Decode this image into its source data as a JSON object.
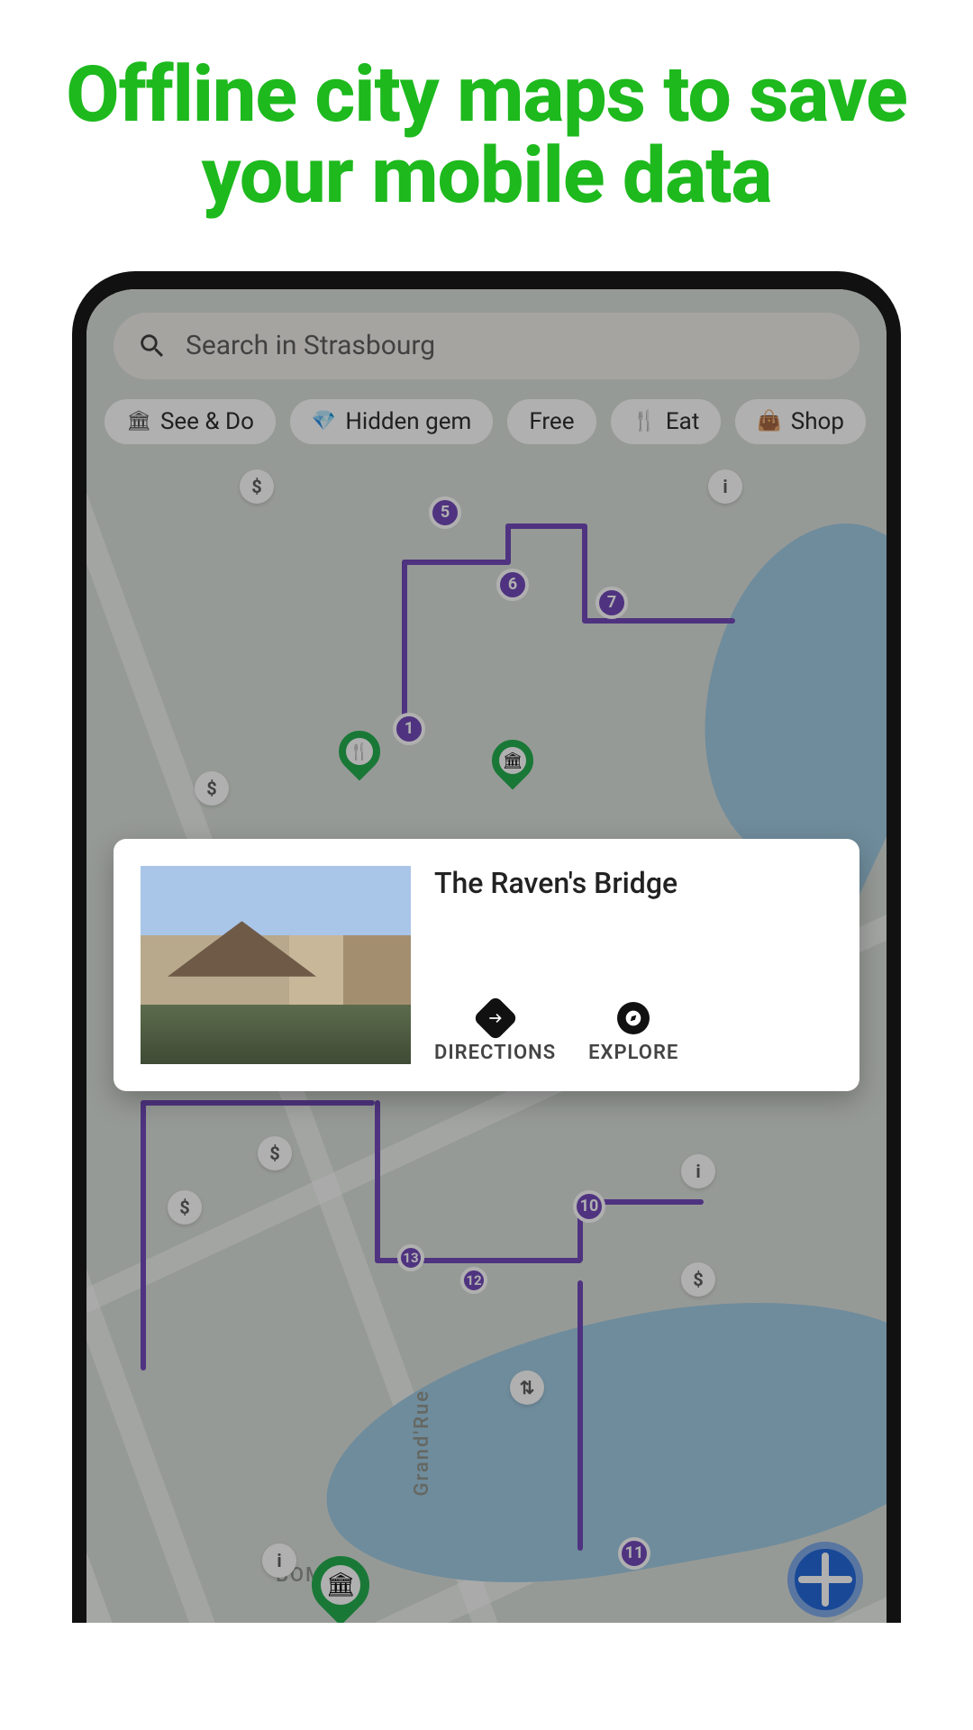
{
  "promo": {
    "headline": "Offline city maps to save your mobile data"
  },
  "search": {
    "placeholder": "Search in Strasbourg"
  },
  "chips": [
    {
      "icon": "museum-icon",
      "glyph": "🏛",
      "label": "See & Do"
    },
    {
      "icon": "gem-icon",
      "glyph": "💎",
      "label": "Hidden gem"
    },
    {
      "icon": null,
      "glyph": "",
      "label": "Free"
    },
    {
      "icon": "fork-icon",
      "glyph": "🍴",
      "label": "Eat"
    },
    {
      "icon": "bag-icon",
      "glyph": "👜",
      "label": "Shop"
    }
  ],
  "card": {
    "title": "The Raven's Bridge",
    "actions": {
      "directions_label": "DIRECTIONS",
      "explore_label": "EXPLORE"
    }
  },
  "route_stops": {
    "s1": "1",
    "s5": "5",
    "s6": "6",
    "s7": "7",
    "s10": "10",
    "s11": "11",
    "s12": "12",
    "s13": "13"
  },
  "map_labels": {
    "boma": "BOMA",
    "grandrue": "Grand'Rue"
  },
  "glyphs": {
    "dollar": "$",
    "info": "i",
    "crossing": "⇅"
  },
  "poi_icons": {
    "food": "🍴",
    "museum": "🏛"
  }
}
